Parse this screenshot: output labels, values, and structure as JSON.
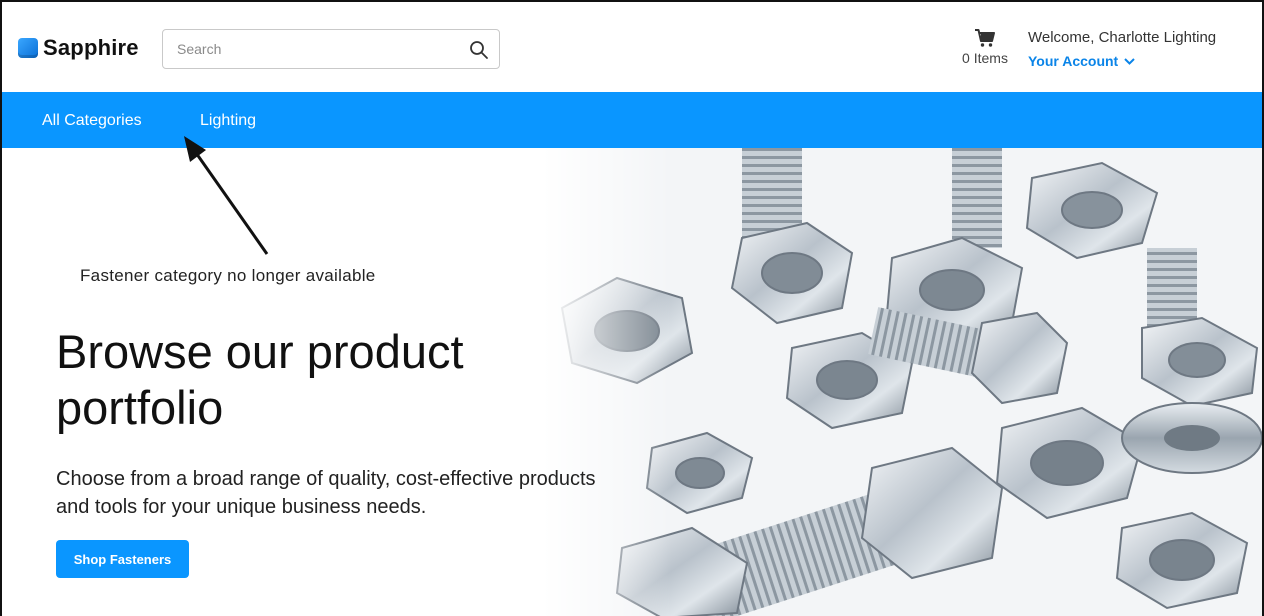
{
  "header": {
    "brand": "Sapphire",
    "search": {
      "placeholder": "Search",
      "value": ""
    },
    "cart": {
      "count_label": "0 Items"
    },
    "welcome": "Welcome, Charlotte Lighting",
    "account_label": "Your Account"
  },
  "nav": {
    "items": [
      {
        "label": "All Categories"
      },
      {
        "label": "Lighting"
      }
    ]
  },
  "annotation": {
    "text": "Fastener category no longer available"
  },
  "hero": {
    "title": "Browse our product portfolio",
    "subtitle": "Choose from a broad range of quality, cost-effective products and tools for your unique business needs.",
    "cta_label": "Shop Fasteners"
  },
  "colors": {
    "brand_blue": "#0a96ff",
    "link_blue": "#0a84e8"
  }
}
